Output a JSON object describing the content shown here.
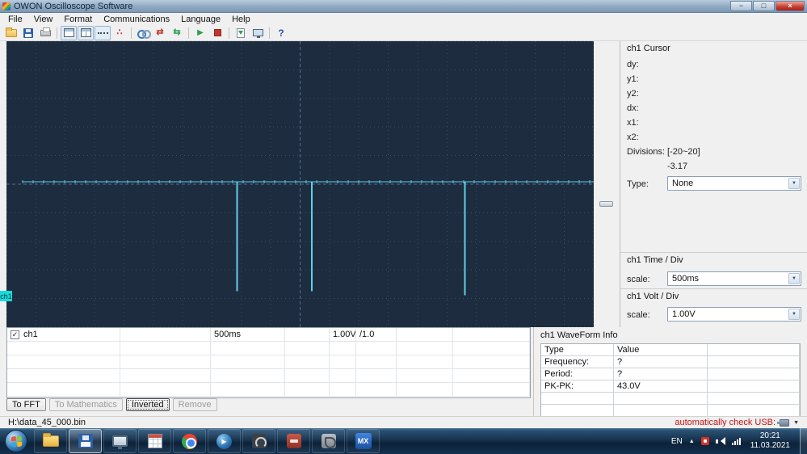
{
  "window": {
    "title": "OWON Oscilloscope Software",
    "controls": {
      "minimize": "−",
      "maximize": "□",
      "close": "×"
    }
  },
  "icons": {
    "dropdown": "▼",
    "hidden_icons_arrow": "▲",
    "checkmark": "✓"
  },
  "menu": {
    "items": [
      "File",
      "View",
      "Format",
      "Communications",
      "Language",
      "Help"
    ]
  },
  "toolbar": {
    "buttons": [
      {
        "name": "open-file-button",
        "icon": "folder"
      },
      {
        "name": "save-button",
        "icon": "floppy"
      },
      {
        "name": "print-button",
        "icon": "printer"
      },
      {
        "sep": true
      },
      {
        "name": "single-view-button",
        "icon": "grid1",
        "pressed": true
      },
      {
        "name": "split-view-button",
        "icon": "grid2",
        "pressed": true
      },
      {
        "name": "dotted-line-view-button",
        "icon": "dots",
        "pressed": true
      },
      {
        "name": "points-view-button",
        "icon": "points",
        "glyph": "∴"
      },
      {
        "sep": true
      },
      {
        "name": "connect-device-button",
        "icon": "link"
      },
      {
        "name": "upload-button",
        "icon": "red",
        "glyph": "⇄"
      },
      {
        "name": "download-button",
        "icon": "green",
        "glyph": "⇆"
      },
      {
        "sep": true
      },
      {
        "name": "run-button",
        "icon": "play",
        "glyph": "▶"
      },
      {
        "name": "stop-button",
        "icon": "stop"
      },
      {
        "sep": true
      },
      {
        "name": "export-data-button",
        "icon": "export"
      },
      {
        "name": "screen-capture-button",
        "icon": "monitor"
      },
      {
        "sep": true
      },
      {
        "name": "help-button",
        "icon": "help",
        "glyph": "?"
      }
    ]
  },
  "scope": {
    "channel_label": "ch1",
    "bg": "#1d2c3f",
    "grid_color": "#384e66",
    "axis_color": "#52708e",
    "grid": {
      "cols": 20,
      "rows": 10
    },
    "trace": {
      "color": "#5fd0e8",
      "baseline_frac": 0.492,
      "start_frac": 0.027,
      "spikes": [
        {
          "x_frac": 0.392,
          "bottom_frac": 0.873
        },
        {
          "x_frac": 0.519,
          "bottom_frac": 0.873
        },
        {
          "x_frac": 0.78,
          "bottom_frac": 0.887
        }
      ]
    }
  },
  "cursor_panel": {
    "title": "ch1 Cursor",
    "fields": [
      "dy:",
      "y1:",
      "y2:",
      "dx:",
      "x1:",
      "x2:"
    ],
    "divisions_label": "Divisions:",
    "divisions_value": "[-20~20]",
    "divisions_current": "-3.17",
    "type_label": "Type:",
    "type_value": "None"
  },
  "time_div_panel": {
    "title": "ch1 Time / Div",
    "scale_label": "scale:",
    "scale_value": "500ms"
  },
  "volt_div_panel": {
    "title": "ch1 Volt / Div",
    "scale_label": "scale:",
    "scale_value": "1.00V"
  },
  "channel_table": {
    "row": {
      "checked": true,
      "name": "ch1",
      "time": "500ms",
      "volt": "1.00V",
      "factor": "/1.0"
    },
    "empty_rows": 4
  },
  "actions": {
    "to_fft": "To FFT",
    "to_math": "To Mathematics",
    "inverted": "Inverted",
    "remove": "Remove"
  },
  "waveform_info": {
    "title": "ch1 WaveForm Info",
    "columns": [
      "Type",
      "Value",
      ""
    ],
    "rows": [
      [
        "Frequency:",
        "?"
      ],
      [
        "Period:",
        "?"
      ],
      [
        "PK-PK:",
        "43.0V"
      ],
      [
        "",
        ""
      ],
      [
        "",
        ""
      ]
    ]
  },
  "statusbar": {
    "file": "H:\\data_45_000.bin",
    "usb_text": "automatically check USB:"
  },
  "taskbar": {
    "apps": [
      {
        "name": "explorer",
        "icon": "folder"
      },
      {
        "name": "owon-software",
        "icon": "floppy",
        "active": true
      },
      {
        "name": "app-3",
        "icon": "monitor"
      },
      {
        "name": "app-4",
        "icon": "grid"
      },
      {
        "name": "chrome",
        "icon": "chrome"
      },
      {
        "name": "media-player",
        "icon": "player"
      },
      {
        "name": "app-7",
        "icon": "dark"
      },
      {
        "name": "app-8",
        "icon": "red"
      },
      {
        "name": "app-9",
        "icon": "tool"
      },
      {
        "name": "mx-app",
        "icon": "mx",
        "label": "MX"
      }
    ],
    "tray": {
      "lang": "EN",
      "time": "20:21",
      "date": "11.03.2021"
    }
  }
}
